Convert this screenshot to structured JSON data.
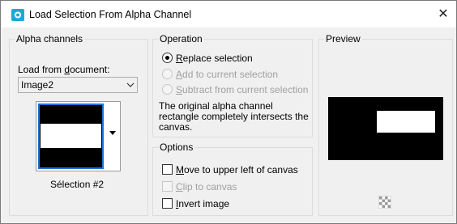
{
  "window": {
    "title": "Load Selection From Alpha Channel"
  },
  "alpha": {
    "group_label": "Alpha channels",
    "load_from_label": "Load from document:",
    "document_value": "Image2",
    "selection_label": "Sélection #2"
  },
  "operation": {
    "group_label": "Operation",
    "replace": "Replace selection",
    "add": "Add to current selection",
    "subtract": "Subtract from current selection",
    "selected": "replace",
    "description": "The original alpha channel rectangle completely intersects the canvas."
  },
  "options": {
    "group_label": "Options",
    "move": "Move to upper left of canvas",
    "move_checked": false,
    "clip": "Clip to canvas",
    "clip_enabled": false,
    "invert": "Invert image",
    "invert_checked": false
  },
  "preview": {
    "group_label": "Preview"
  },
  "colors": {
    "accent": "#1e6fd9",
    "app_icon": "#1fa7d6"
  },
  "icons": {
    "app": "paint-shop-icon",
    "close": "close-icon",
    "transparency": "checkerboard-icon",
    "dropdown": "chevron-down-icon"
  }
}
